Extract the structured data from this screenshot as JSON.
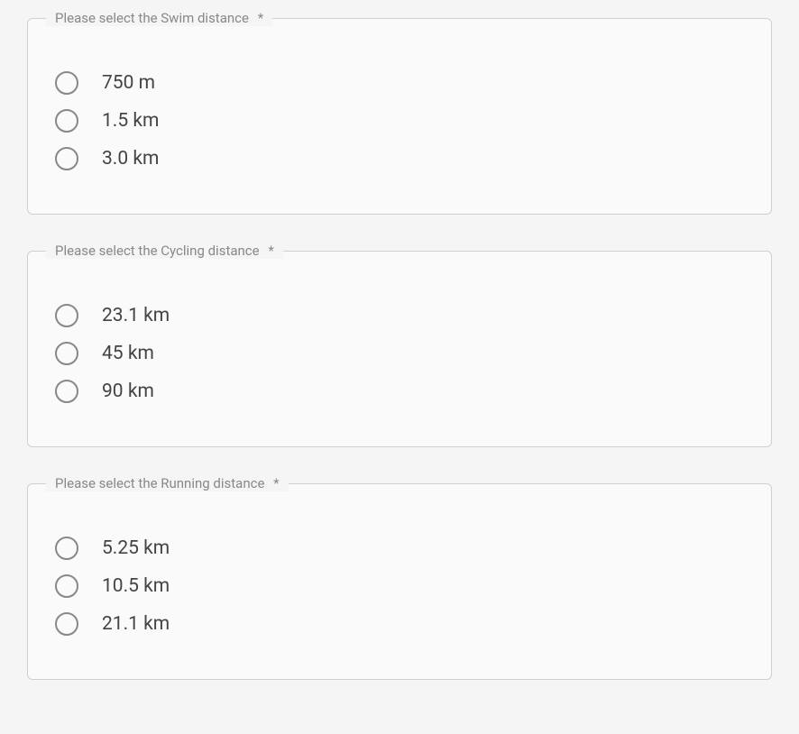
{
  "groups": [
    {
      "id": "swim",
      "legend": "Please select the Swim distance",
      "required": true,
      "options": [
        "750 m",
        "1.5 km",
        "3.0 km"
      ]
    },
    {
      "id": "cycling",
      "legend": "Please select the Cycling distance",
      "required": true,
      "options": [
        "23.1 km",
        "45 km",
        "90 km"
      ]
    },
    {
      "id": "running",
      "legend": "Please select the Running distance",
      "required": true,
      "options": [
        "5.25 km",
        "10.5 km",
        "21.1 km"
      ]
    }
  ],
  "required_marker": "*"
}
